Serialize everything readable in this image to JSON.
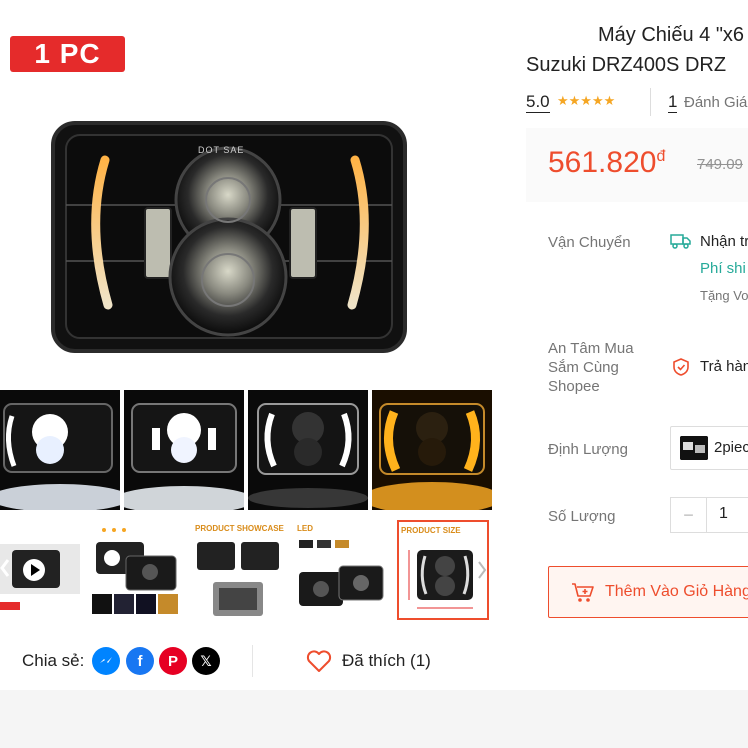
{
  "product": {
    "badge": "1 PC",
    "title_line1": "Máy Chiếu 4 \"x6",
    "title_line2": "Suzuki DRZ400S DRZ",
    "rating": "5.0",
    "stars": "★★★★★",
    "review_count": "1",
    "review_label": "Đánh Giá",
    "price": "561.820",
    "currency": "đ",
    "old_price": "749.09"
  },
  "image_text": {
    "dot_sae": "DOT SAE",
    "product_showcase": "PRODUCT SHOWCASE",
    "led": "LED",
    "product_size": "PRODUCT SIZE"
  },
  "shipping": {
    "label": "Vận Chuyển",
    "text": "Nhận tr",
    "fee": "Phí shi",
    "voucher": "Tặng Vo"
  },
  "guarantee": {
    "label": "An Tâm Mua Sắm Cùng Shopee",
    "text": "Trả hàn"
  },
  "variant": {
    "label": "Định Lượng",
    "option": "2piec"
  },
  "quantity": {
    "label": "Số Lượng",
    "minus": "−",
    "value": "1"
  },
  "cart": {
    "label": "Thêm Vào Giỏ Hàng"
  },
  "share": {
    "label": "Chia sẻ:",
    "liked": "Đã thích (1)"
  },
  "colors": {
    "accent": "#ee4d2d",
    "badge": "#e52b2b",
    "star": "#f5a623",
    "teal": "#26aa99"
  }
}
